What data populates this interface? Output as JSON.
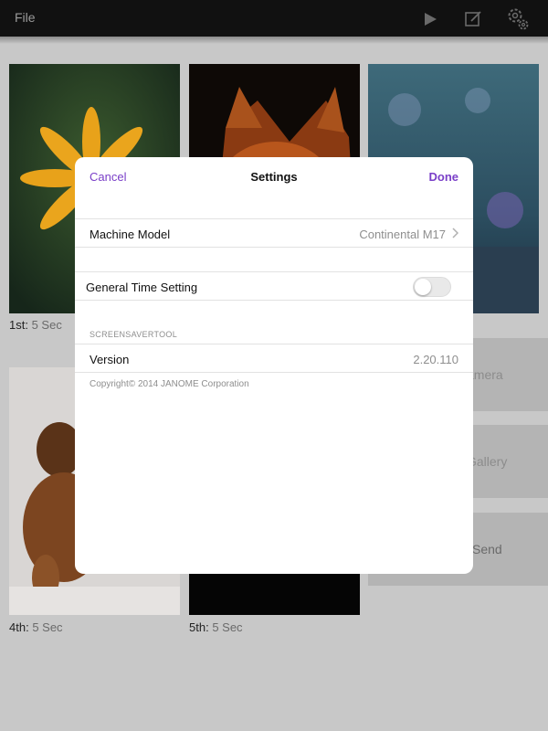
{
  "toolbar": {
    "file_label": "File",
    "icons": [
      "play-icon",
      "edit-icon",
      "settings-gear-icon"
    ]
  },
  "grid": {
    "captions": [
      {
        "ordinal": "1st:",
        "duration": "5 Sec"
      },
      {
        "ordinal": "4th:",
        "duration": "5 Sec"
      },
      {
        "ordinal": "5th:",
        "duration": "5 Sec"
      }
    ],
    "side_buttons": [
      "amera",
      "Gallery",
      "Send"
    ]
  },
  "modal": {
    "cancel_label": "Cancel",
    "title": "Settings",
    "done_label": "Done",
    "machine_model": {
      "label": "Machine Model",
      "value": "Continental M17"
    },
    "general_time": {
      "label": "General Time Setting",
      "enabled": false
    },
    "section_header": "SCREENSAVERTOOL",
    "version": {
      "label": "Version",
      "value": "2.20.110"
    },
    "copyright": "Copyright© 2014 JANOME Corporation"
  },
  "colors": {
    "accent": "#7a3fc8",
    "toolbar_bg": "#111111",
    "backdrop": "#c8c8c8"
  }
}
